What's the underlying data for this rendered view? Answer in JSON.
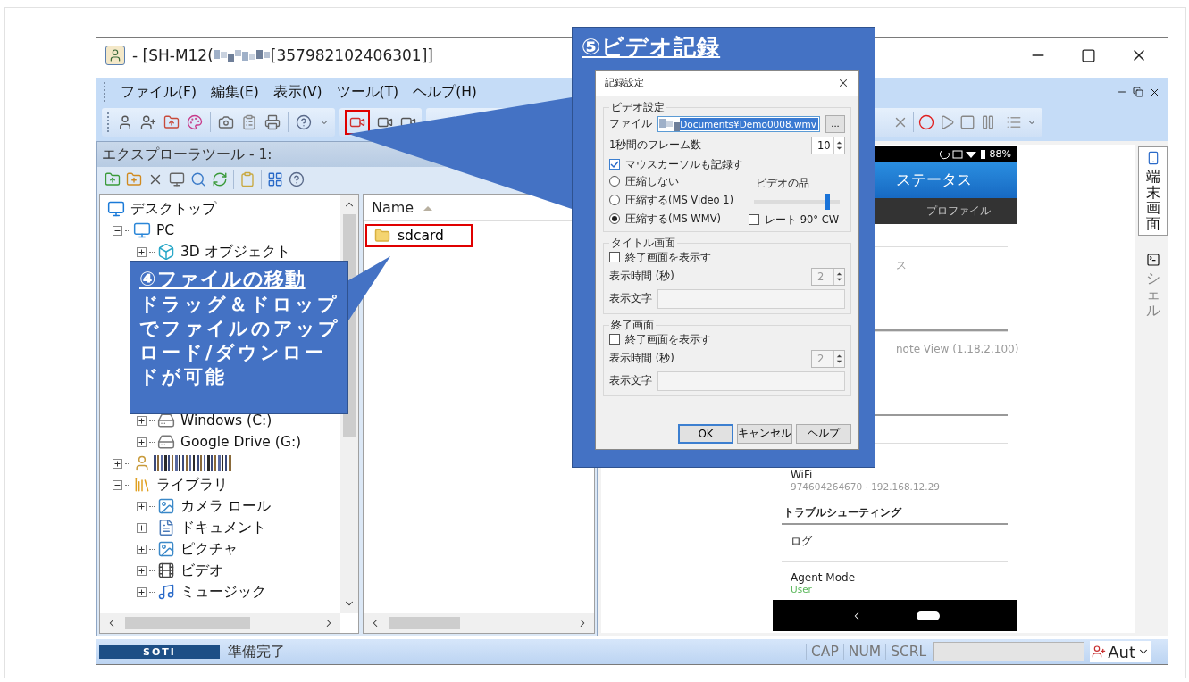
{
  "window": {
    "title_prefix": "- [SH-M12(",
    "title_suffix": "[357982102406301]]"
  },
  "menu": [
    "ファイル(F)",
    "編集(E)",
    "表示(V)",
    "ツール(T)",
    "ヘルプ(H)"
  ],
  "explorer": {
    "title": "エクスプローラツール - 1:",
    "tree": [
      {
        "label": "デスクトップ",
        "kind": "desktop",
        "children": [
          {
            "label": "PC",
            "kind": "pc",
            "expanded": true,
            "children": [
              {
                "label": "3D オブジェクト",
                "kind": "cube",
                "expanded": false,
                "covered_below": true
              },
              {
                "label": "Windows (C:)",
                "kind": "drive",
                "expanded": false
              },
              {
                "label": "Google Drive (G:)",
                "kind": "drive",
                "expanded": false
              }
            ]
          },
          {
            "kind": "redacted",
            "expanded": false
          },
          {
            "label": "ライブラリ",
            "kind": "library",
            "expanded": true,
            "children": [
              {
                "label": "カメラ ロール",
                "kind": "pictures",
                "expanded": false
              },
              {
                "label": "ドキュメント",
                "kind": "documents",
                "expanded": false
              },
              {
                "label": "ピクチャ",
                "kind": "pictures",
                "expanded": false
              },
              {
                "label": "ビデオ",
                "kind": "videos",
                "expanded": false
              },
              {
                "label": "ミュージック",
                "kind": "music",
                "expanded": false
              }
            ]
          }
        ]
      }
    ],
    "column": {
      "label": "Name",
      "sorted": true
    },
    "files": [
      {
        "name": "sdcard",
        "highlighted": true
      }
    ]
  },
  "callouts": [
    {
      "title": "④ファイルの移動",
      "body": "ドラッグ＆ドロップでファイルのアップロード/ダウンロードが可能"
    },
    {
      "title": "⑤ビデオ記録"
    }
  ],
  "dialog": {
    "title": "記録設定",
    "video": {
      "legend": "ビデオ設定",
      "file_label": "ファイル",
      "file_value": "Documents¥Demo0008.wmv",
      "browse": "...",
      "fps_label": "1秒間のフレーム数",
      "fps": {
        "value": "10",
        "disabled": false
      },
      "cursor": {
        "label": "マウスカーソルも記録す",
        "checked": true
      },
      "compression": [
        {
          "label": "圧縮しない",
          "selected": false
        },
        {
          "label": "圧縮する(MS Video 1)",
          "selected": false
        },
        {
          "label": "圧縮する(MS WMV)",
          "selected": true
        }
      ],
      "quality_label": "ビデオの品",
      "quality": {
        "level": 0.85
      },
      "rotate": {
        "label": "レート 90° CW",
        "checked": false
      }
    },
    "screens": [
      {
        "legend": "タイトル画面",
        "show": {
          "label": "終了画面を表示す",
          "checked": false
        },
        "duration_label": "表示時間 (秒)",
        "duration": {
          "value": "2",
          "disabled": true
        },
        "text_label": "表示文字"
      },
      {
        "legend": "終了画面",
        "show": {
          "label": "終了画面を表示す",
          "checked": false
        },
        "duration_label": "表示時間 (秒)",
        "duration": {
          "value": "2",
          "disabled": true
        },
        "text_label": "表示文字"
      }
    ],
    "buttons": [
      {
        "label": "OK",
        "default": true
      },
      {
        "label": "キャンセル",
        "default": false
      },
      {
        "label": "ヘルプ",
        "default": false
      }
    ]
  },
  "phone": {
    "battery": "88%",
    "header": "ステータス",
    "tab": "プロファイル",
    "items": [
      {
        "kind": "fragment",
        "text": "ス"
      },
      {
        "kind": "fragment",
        "text": "note View (1.18.2.100)"
      },
      {
        "kind": "setting",
        "title": "WiFi",
        "value": "974604264670 · 192.168.12.29"
      },
      {
        "kind": "section",
        "text": "トラブルシューティング"
      },
      {
        "kind": "setting",
        "title": "ログ"
      },
      {
        "kind": "mode",
        "title": "Agent Mode",
        "value": "User"
      }
    ]
  },
  "side_tabs": [
    {
      "label": "端末画面",
      "kind": "phone",
      "selected": true
    },
    {
      "label": "シェル",
      "kind": "shell",
      "selected": false
    }
  ],
  "status_bar": {
    "logo": "SOTI",
    "message": "準備完了",
    "indicators": [
      "CAP",
      "NUM",
      "SCRL"
    ],
    "mode": "Aut"
  }
}
